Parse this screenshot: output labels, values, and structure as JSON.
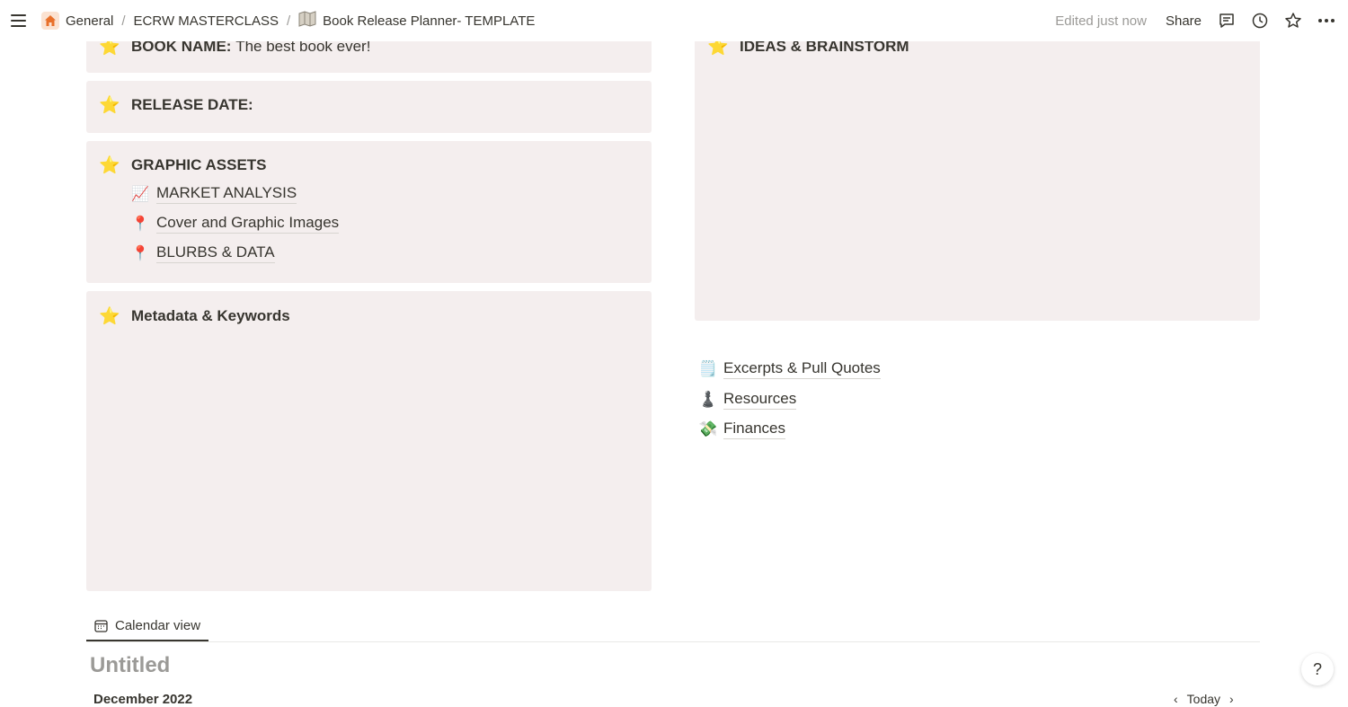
{
  "topbar": {
    "breadcrumbs": [
      {
        "label": "General",
        "icon": "home-icon"
      },
      {
        "label": "ECRW MASTERCLASS"
      },
      {
        "label": "Book Release Planner- TEMPLATE",
        "icon": "map-icon"
      }
    ],
    "separator": "/",
    "edited": "Edited just now",
    "share": "Share"
  },
  "left_column": {
    "book_name": {
      "label": "BOOK NAME:",
      "value": "The best book ever!"
    },
    "release_date": {
      "label": "RELEASE DATE:"
    },
    "graphic_assets": {
      "title": "GRAPHIC ASSETS",
      "items": [
        {
          "icon": "📈",
          "label": "MARKET ANALYSIS"
        },
        {
          "icon": "📍",
          "label": "Cover and Graphic Images"
        },
        {
          "icon": "📍",
          "label": "BLURBS & DATA"
        }
      ]
    },
    "metadata": {
      "title": "Metadata & Keywords"
    }
  },
  "right_column": {
    "ideas": {
      "title": "IDEAS & BRAINSTORM"
    },
    "pages": [
      {
        "icon": "🗒️",
        "label": "Excerpts & Pull Quotes"
      },
      {
        "icon": "♟️",
        "label": "Resources"
      },
      {
        "icon": "💸",
        "label": "Finances"
      }
    ]
  },
  "database": {
    "tab_label": "Calendar view",
    "title": "Untitled",
    "month": "December 2022",
    "today": "Today"
  },
  "help_label": "?",
  "colors": {
    "callout_bg": "#f4eeee",
    "text": "#37352f",
    "muted": "#9b9a97"
  }
}
